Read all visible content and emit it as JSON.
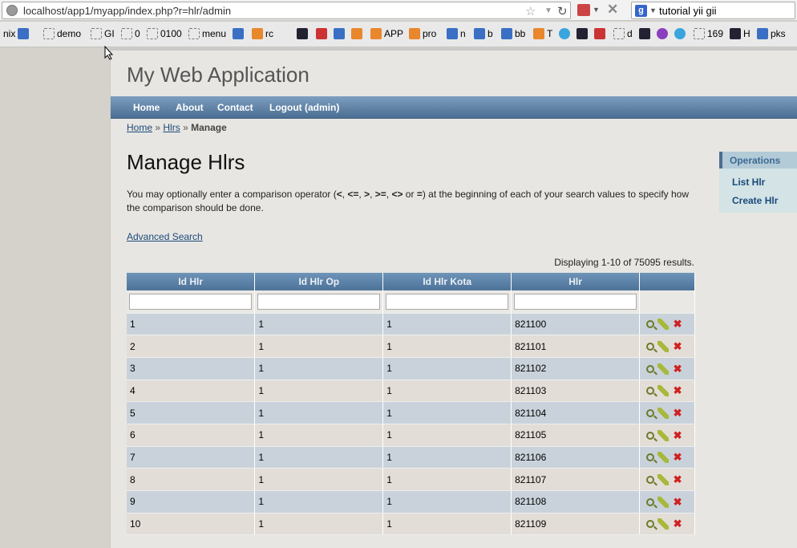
{
  "browser": {
    "url": "localhost/app1/myapp/index.php?r=hlr/admin",
    "search_query": "tutorial yii gii"
  },
  "bookmarks": [
    {
      "label": "nix",
      "icon": "magnifier-icon"
    },
    {
      "label": "demo",
      "icon": "dashed-box-icon"
    },
    {
      "label": "GI",
      "icon": "dashed-box-icon"
    },
    {
      "label": "0",
      "icon": "dashed-box-icon"
    },
    {
      "label": "0100",
      "icon": "dashed-box-icon"
    },
    {
      "label": "menu",
      "icon": "dashed-box-icon"
    },
    {
      "label": "rc",
      "icon": "orange-icon"
    },
    {
      "label": "APP",
      "icon": "orange-icon"
    },
    {
      "label": "pro",
      "icon": "orange-icon"
    },
    {
      "label": "n",
      "icon": "blue-icon"
    },
    {
      "label": "b",
      "icon": "blue-icon"
    },
    {
      "label": "bb",
      "icon": "blue-icon"
    },
    {
      "label": "T",
      "icon": "twitter-icon"
    },
    {
      "label": "d",
      "icon": "dashed-box-icon"
    },
    {
      "label": "169",
      "icon": "dashed-box-icon"
    },
    {
      "label": "H",
      "icon": "dark-icon"
    },
    {
      "label": "pks",
      "icon": "google-icon"
    }
  ],
  "site": {
    "title": "My Web Application",
    "menu": [
      "Home",
      "About",
      "Contact",
      "Logout (admin)"
    ]
  },
  "breadcrumb": {
    "home": "Home",
    "sep1": "»",
    "hlrs": "Hlrs",
    "sep2": "»",
    "current": "Manage"
  },
  "main": {
    "title": "Manage Hlrs",
    "intro_part1": "You may optionally enter a comparison operator (",
    "op1": "<",
    "op2": "<=",
    "op3": ">",
    "op4": ">=",
    "op5": "<>",
    "op_or": " or ",
    "op6": "=",
    "intro_part2": ") at the beginning of each of your search values to specify how the comparison should be done.",
    "advanced_search": "Advanced Search",
    "summary": "Displaying 1-10 of 75095 results."
  },
  "grid": {
    "columns": [
      "Id Hlr",
      "Id Hlr Op",
      "Id Hlr Kota",
      "Hlr",
      ""
    ],
    "rows": [
      [
        "1",
        "1",
        "1",
        "821100"
      ],
      [
        "2",
        "1",
        "1",
        "821101"
      ],
      [
        "3",
        "1",
        "1",
        "821102"
      ],
      [
        "4",
        "1",
        "1",
        "821103"
      ],
      [
        "5",
        "1",
        "1",
        "821104"
      ],
      [
        "6",
        "1",
        "1",
        "821105"
      ],
      [
        "7",
        "1",
        "1",
        "821106"
      ],
      [
        "8",
        "1",
        "1",
        "821107"
      ],
      [
        "9",
        "1",
        "1",
        "821108"
      ],
      [
        "10",
        "1",
        "1",
        "821109"
      ]
    ]
  },
  "sidebar": {
    "title": "Operations",
    "links": [
      "List Hlr",
      "Create Hlr"
    ]
  }
}
